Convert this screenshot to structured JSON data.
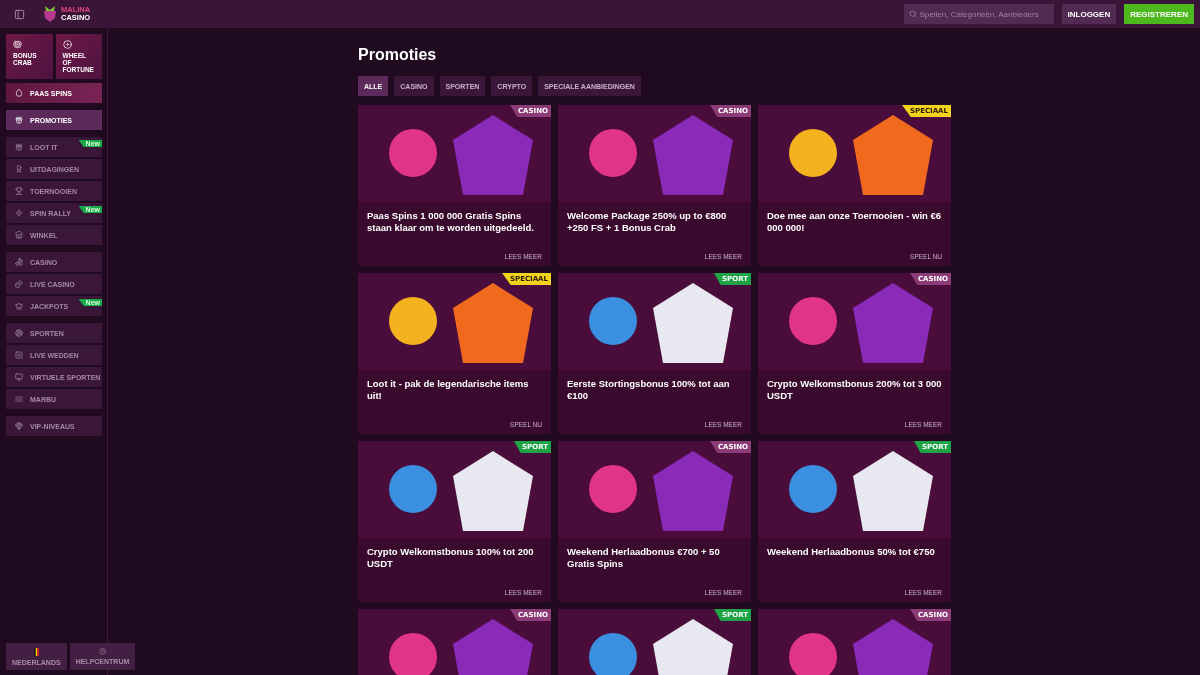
{
  "topbar": {
    "logo": {
      "line1": "MALINA",
      "line2": "CASINO"
    },
    "search": {
      "placeholder": "Spellen, Categorieën, Aanbieders"
    },
    "login": "INLOGGEN",
    "register": "REGISTREREN"
  },
  "sidebar": {
    "tiles": [
      {
        "label": "BONUS CRAB"
      },
      {
        "label": "WHEEL OF FORTUNE"
      }
    ],
    "feature": {
      "label": "PAAS SPINS"
    },
    "groups": [
      [
        {
          "label": "PROMOTIES",
          "selected": true
        }
      ],
      [
        {
          "label": "LOOT IT",
          "selected": false,
          "badge": "New"
        },
        {
          "label": "UITDAGINGEN",
          "selected": false
        },
        {
          "label": "TOERNOOIEN",
          "selected": false
        },
        {
          "label": "SPIN RALLY",
          "selected": false,
          "badge": "New"
        },
        {
          "label": "WINKEL",
          "selected": false
        }
      ],
      [
        {
          "label": "CASINO",
          "selected": false
        },
        {
          "label": "LIVE CASINO",
          "selected": false
        },
        {
          "label": "JACKPOTS",
          "selected": false,
          "badge": "New"
        }
      ],
      [
        {
          "label": "SPORTEN",
          "selected": false
        },
        {
          "label": "LIVE WEDDEN",
          "selected": false
        },
        {
          "label": "VIRTUELE SPORTEN",
          "selected": false
        },
        {
          "label": "MARBU",
          "selected": false
        }
      ],
      [
        {
          "label": "VIP-NIVEAUS",
          "selected": false
        }
      ]
    ],
    "footer": [
      {
        "label": "NEDERLANDS",
        "kind": "language"
      },
      {
        "label": "HELPCENTRUM",
        "kind": "help"
      }
    ]
  },
  "main": {
    "title": "Promoties",
    "filters": [
      {
        "label": "ALLE",
        "selected": true
      },
      {
        "label": "CASINO",
        "selected": false
      },
      {
        "label": "SPORTEN",
        "selected": false
      },
      {
        "label": "CRYPTO",
        "selected": false
      },
      {
        "label": "SPECIALE AANBIEDINGEN",
        "selected": false
      }
    ],
    "promos": [
      {
        "tag": "CASINO",
        "kind": "casino",
        "title": "Paas Spins 1 000 000 Gratis Spins staan klaar om te worden uitgedeeld.",
        "action": "LEES MEER"
      },
      {
        "tag": "CASINO",
        "kind": "casino",
        "title": "Welcome Package 250% up to €800 +250 FS + 1 Bonus Crab",
        "action": "LEES MEER"
      },
      {
        "tag": "SPECIAAL",
        "kind": "special",
        "title": "Doe mee aan onze Toernooien - win €6 000 000!",
        "action": "SPEEL NU"
      },
      {
        "tag": "SPECIAAL",
        "kind": "special",
        "title": "Loot it - pak de legendarische items uit!",
        "action": "SPEEL NU"
      },
      {
        "tag": "SPORT",
        "kind": "sport",
        "title": "Eerste Stortingsbonus 100% tot aan €100",
        "action": "LEES MEER"
      },
      {
        "tag": "CASINO",
        "kind": "casino",
        "title": "Crypto Welkomstbonus 200% tot 3 000 USDT",
        "action": "LEES MEER"
      },
      {
        "tag": "SPORT",
        "kind": "sport",
        "title": "Crypto Welkomstbonus 100% tot 200 USDT",
        "action": "LEES MEER"
      },
      {
        "tag": "CASINO",
        "kind": "casino",
        "title": "Weekend Herlaadbonus €700 + 50 Gratis Spins",
        "action": "LEES MEER"
      },
      {
        "tag": "SPORT",
        "kind": "sport",
        "title": "Weekend Herlaadbonus 50% tot €750",
        "action": "LEES MEER"
      },
      {
        "tag": "CASINO",
        "kind": "casino"
      },
      {
        "tag": "SPORT",
        "kind": "sport"
      },
      {
        "tag": "CASINO",
        "kind": "casino"
      }
    ]
  }
}
